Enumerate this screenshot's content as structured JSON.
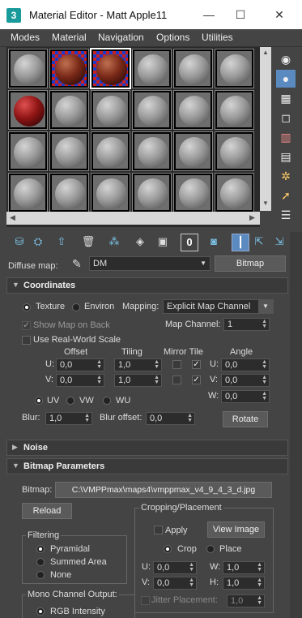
{
  "window": {
    "title": "Material Editor - Matt Apple11",
    "icon": "3",
    "minimize": "—",
    "maximize": "☐",
    "close": "✕"
  },
  "menu": [
    "Modes",
    "Material",
    "Navigation",
    "Options",
    "Utilities"
  ],
  "diffuse": {
    "label": "Diffuse map:",
    "name": "DM",
    "type": "Bitmap"
  },
  "coordinates": {
    "header": "Coordinates",
    "texture": "Texture",
    "environ": "Environ",
    "mapping_label": "Mapping:",
    "mapping_value": "Explicit Map Channel",
    "show_map_on_back": "Show Map on Back",
    "map_channel_label": "Map Channel:",
    "map_channel": "1",
    "real_world": "Use Real-World Scale",
    "offset": "Offset",
    "tiling": "Tiling",
    "mirror_tile": "Mirror Tile",
    "angle": "Angle",
    "u": "U:",
    "v": "V:",
    "w": "W:",
    "u_offset": "0,0",
    "v_offset": "0,0",
    "u_tiling": "1,0",
    "v_tiling": "1,0",
    "u_angle": "0,0",
    "v_angle": "0,0",
    "w_angle": "0,0",
    "uv": "UV",
    "vw": "VW",
    "wu": "WU",
    "blur_label": "Blur:",
    "blur": "1,0",
    "blur_offset_label": "Blur offset:",
    "blur_offset": "0,0",
    "rotate": "Rotate"
  },
  "noise": {
    "header": "Noise"
  },
  "bitmap_params": {
    "header": "Bitmap Parameters",
    "bitmap_label": "Bitmap:",
    "bitmap_path": "C:\\VMPPmax\\maps4\\vmppmax_v4_9_4_3_d.jpg",
    "reload": "Reload",
    "cropping": "Cropping/Placement",
    "apply": "Apply",
    "view_image": "View Image",
    "crop": "Crop",
    "place": "Place",
    "u": "U:",
    "v": "V:",
    "w": "W:",
    "h": "H:",
    "u_val": "0,0",
    "v_val": "0,0",
    "w_val": "1,0",
    "h_val": "1,0",
    "jitter": "Jitter Placement:",
    "jitter_val": "1,0",
    "filtering": "Filtering",
    "pyramidal": "Pyramidal",
    "summed": "Summed Area",
    "none": "None",
    "mono": "Mono Channel Output:",
    "rgb": "RGB Intensity"
  }
}
